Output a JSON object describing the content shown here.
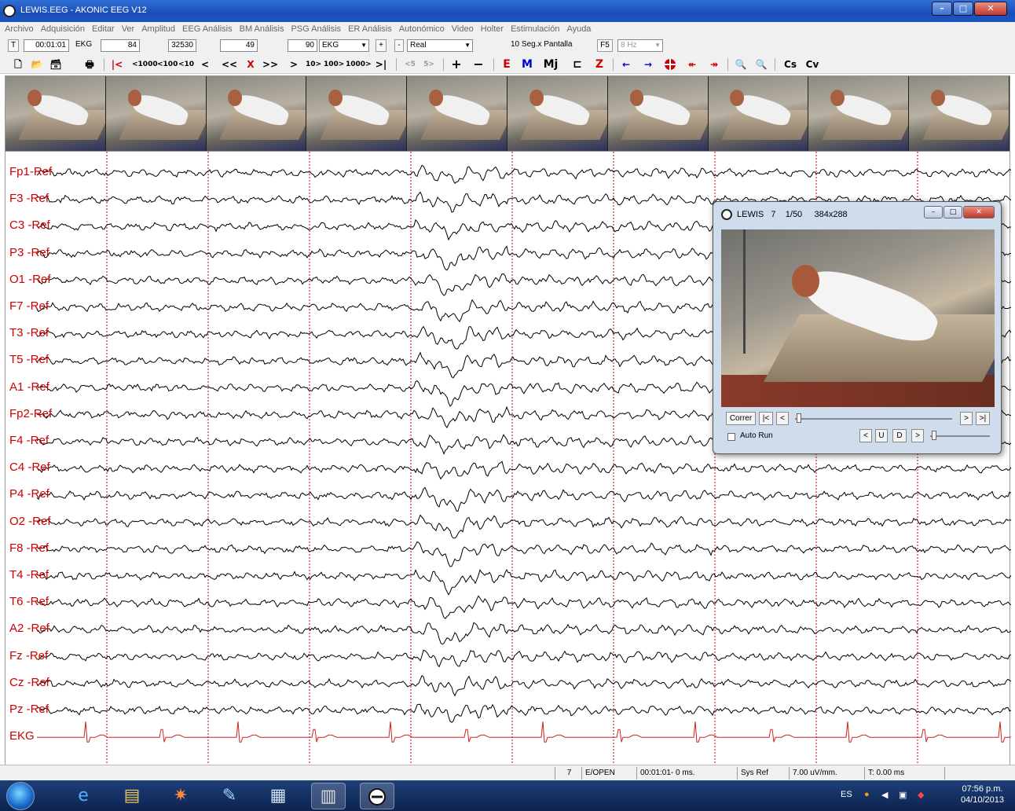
{
  "window": {
    "title": "LEWIS.EEG - AKONIC EEG V12"
  },
  "menu": [
    "Archivo",
    "Adquisición",
    "Editar",
    "Ver",
    "Amplitud",
    "EEG Análisis",
    "BM Análisis",
    "PSG Análisis",
    "ER Análisis",
    "Autonómico",
    "Video",
    "Holter",
    "Estimulación",
    "Ayuda"
  ],
  "params": {
    "t_label": "T",
    "time": "00:01:01",
    "ekg_label": "EKG",
    "val1": "84",
    "val2": "32530",
    "val3": "49",
    "val4": "90",
    "montage_select": "EKG",
    "plus": "+",
    "minus": "-",
    "mode_select": "Real",
    "seconds_per_screen": "10 Seg.x Pantalla",
    "f5": "F5",
    "filter_select": "8 Hz"
  },
  "toolbar": {
    "first": "|<",
    "back1000": "<1000",
    "back100": "<100",
    "back10": "<10",
    "back1": "<",
    "back_page": "<<",
    "cancel": "X",
    "fwd_page": ">>",
    "fwd1": ">",
    "fwd10": "10>",
    "fwd100": "100>",
    "fwd1000": "1000>",
    "last": ">|",
    "back5": "<5",
    "fwd5": "5>",
    "add": "+",
    "remove": "−",
    "E": "E",
    "M": "M",
    "Mj": "Mj",
    "bracket": "⊏",
    "Z": "Z",
    "left_arrow": "←",
    "right_arrow": "→",
    "left_double": "↞",
    "right_double": "↠",
    "cs": "Cs",
    "cv": "Cv"
  },
  "channels": [
    "Fp1-Ref",
    "F3 -Ref",
    "C3 -Ref",
    "P3 -Ref",
    "O1 -Ref",
    "F7 -Ref",
    "T3 -Ref",
    "T5 -Ref",
    "A1 -Ref",
    "Fp2-Ref",
    "F4 -Ref",
    "C4 -Ref",
    "P4 -Ref",
    "O2 -Ref",
    "F8 -Ref",
    "T4 -Ref",
    "T6 -Ref",
    "A2 -Ref",
    "Fz -Ref",
    "Cz -Ref",
    "Pz -Ref",
    "EKG"
  ],
  "colors": {
    "label": "#cc0000",
    "trace": "#000000",
    "ekg": "#cc2222",
    "marker": "#cc0000"
  },
  "video_window": {
    "title_name": "LEWIS",
    "title_num": "7",
    "title_frame": "1/50",
    "title_size": "384x288",
    "run_btn": "Correr",
    "start_btn": "|<",
    "prev_btn": "<",
    "next_btn": ">",
    "end_btn": ">|",
    "auto_run": "Auto Run",
    "left_btn": "<",
    "u_btn": "U",
    "d_btn": "D",
    "right_btn": ">"
  },
  "status": {
    "page": "7",
    "mode": "E/OPEN",
    "time": "00:01:01- 0 ms.",
    "ref": "Sys Ref",
    "gain": "7.00 uV/mm.",
    "t": "T: 0.00 ms"
  },
  "taskbar": {
    "lang": "ES",
    "time": "07:56 p.m.",
    "date": "04/10/2013"
  }
}
